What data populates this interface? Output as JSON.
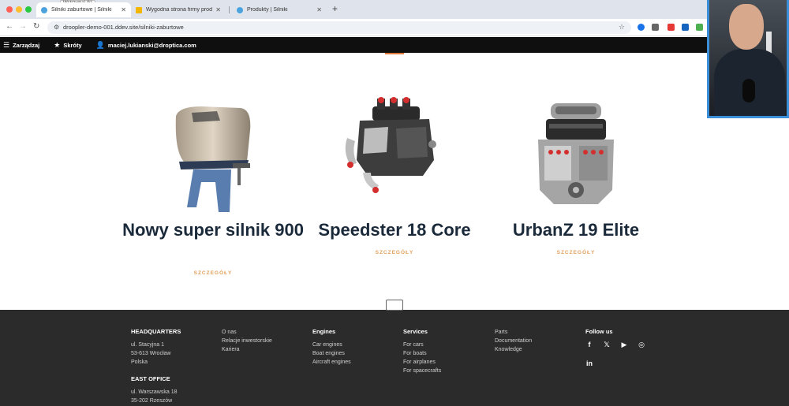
{
  "browser": {
    "tooltip": "Wstrzymaj (k)",
    "tabs": [
      {
        "title": "Silniki zaburtowe | Silniki",
        "favicon_color": "#4aa3df"
      },
      {
        "title": "Wygodna strona firmy produ",
        "favicon_color": "#f2b705"
      },
      {
        "title": "Produkty | Silniki",
        "favicon_color": "#4aa3df"
      }
    ],
    "new_tab": "+",
    "url": "droopler-demo-001.ddev.site/silniki-zaburtowe"
  },
  "admin_toolbar": {
    "manage": "Zarządzaj",
    "shortcuts": "Skróty",
    "user": "maciej.lukianski@droptica.com"
  },
  "products": [
    {
      "title": "Nowy super silnik 900",
      "details": "SZCZEGÓŁY",
      "image": "outboard-motor"
    },
    {
      "title": "Speedster 18 Core",
      "details": "SZCZEGÓŁY",
      "image": "engine-block"
    },
    {
      "title": "UrbanZ 19 Elite",
      "details": "SZCZEGÓŁY",
      "image": "v8-engine"
    }
  ],
  "footer": {
    "headquarters": {
      "heading": "HEADQUARTERS",
      "lines": [
        "ul. Stacyjna 1",
        "53-613 Wrocław",
        "Polska"
      ]
    },
    "east_office": {
      "heading": "EAST OFFICE",
      "lines": [
        "ul. Warszawska 18",
        "35-202 Rzeszów"
      ]
    },
    "company_links": [
      "O nas",
      "Relacje inwestorskie",
      "Kariera"
    ],
    "engines": {
      "heading": "Engines",
      "links": [
        "Car engines",
        "Boat engines",
        "Aircraft engines"
      ]
    },
    "services": {
      "heading": "Services",
      "links": [
        "For cars",
        "For boats",
        "For airplanes",
        "For spacecrafts"
      ]
    },
    "other_links": [
      "Parts",
      "Documentation",
      "Knowledge"
    ],
    "follow": {
      "heading": "Follow us",
      "icons": [
        "facebook-icon",
        "twitter-icon",
        "youtube-icon",
        "instagram-icon",
        "linkedin-icon"
      ]
    }
  },
  "colors": {
    "accent": "#e3a05c",
    "footer_bg": "#2b2b2b",
    "title": "#1b2a3a",
    "admin_bg": "#0f0f0f"
  }
}
